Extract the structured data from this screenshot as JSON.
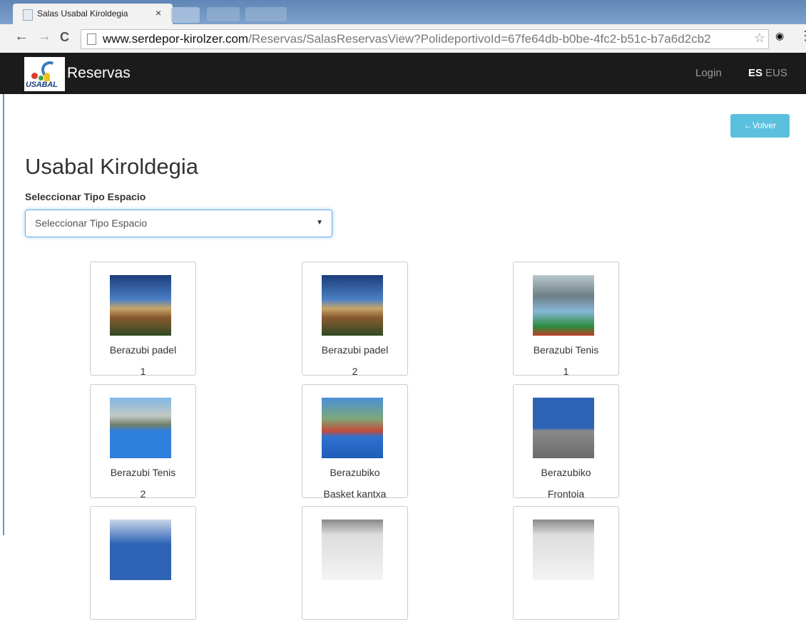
{
  "browser": {
    "tab_title": "Salas Usabal Kiroldegia",
    "tab_close": "×",
    "url_host": "www.serdepor-kirolzer.com",
    "url_path": "/Reservas/SalasReservasView?PolideportivoId=67fe64db-b0be-4fc2-b51c-b7a6d2cb2",
    "back_glyph": "←",
    "forward_glyph": "→",
    "reload_glyph": "C",
    "star_glyph": "☆",
    "menu_glyph": "⋮"
  },
  "navbar": {
    "logo_text": "USABAL",
    "brand": "Reservas",
    "login": "Login",
    "lang_es": "ES",
    "lang_eus": "EUS"
  },
  "content": {
    "back_button": "←Volver",
    "title": "Usabal Kiroldegia",
    "select_label": "Seleccionar Tipo Espacio",
    "select_value": "Seleccionar Tipo Espacio",
    "select_caret": "▼"
  },
  "cards": [
    {
      "line1": "Berazubi padel",
      "line2": "1",
      "image": "padel-court-photo"
    },
    {
      "line1": "Berazubi padel",
      "line2": "2",
      "image": "padel-court-photo"
    },
    {
      "line1": "Berazubi Tenis",
      "line2": "1",
      "image": "tennis-court-photo"
    },
    {
      "line1": "Berazubi Tenis",
      "line2": "2",
      "image": "tennis-court-photo"
    },
    {
      "line1": "Berazubiko",
      "line2": "Basket kantxa",
      "image": "basketball-court-photo"
    },
    {
      "line1": "Berazubiko",
      "line2": "Frontoia",
      "image": "fronton-photo"
    },
    {
      "line1": "",
      "line2": "",
      "image": "indoor-court-photo"
    },
    {
      "line1": "",
      "line2": "",
      "image": "indoor-hall-photo"
    },
    {
      "line1": "",
      "line2": "",
      "image": "indoor-hall-photo"
    }
  ]
}
